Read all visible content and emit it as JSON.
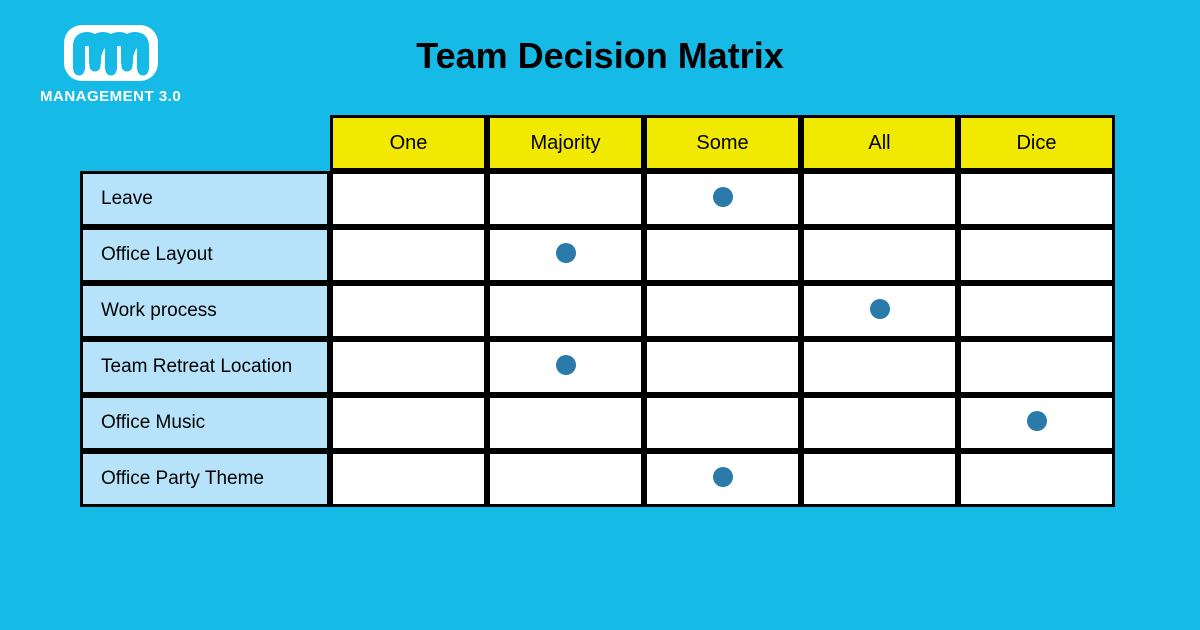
{
  "logo": {
    "brand_text": "MANAGEMENT 3.0"
  },
  "title": "Team Decision Matrix",
  "columns": [
    "One",
    "Majority",
    "Some",
    "All",
    "Dice"
  ],
  "rows": [
    {
      "label": "Leave",
      "selected": "Some"
    },
    {
      "label": "Office Layout",
      "selected": "Majority"
    },
    {
      "label": "Work process",
      "selected": "All"
    },
    {
      "label": "Team Retreat Location",
      "selected": "Majority"
    },
    {
      "label": "Office Music",
      "selected": "Dice"
    },
    {
      "label": "Office Party Theme",
      "selected": "Some"
    }
  ],
  "colors": {
    "background": "#16bae7",
    "header_bg": "#f2e900",
    "row_header_bg": "#b7e3fa",
    "cell_bg": "#ffffff",
    "dot": "#2a7aaa",
    "border": "#000000"
  }
}
